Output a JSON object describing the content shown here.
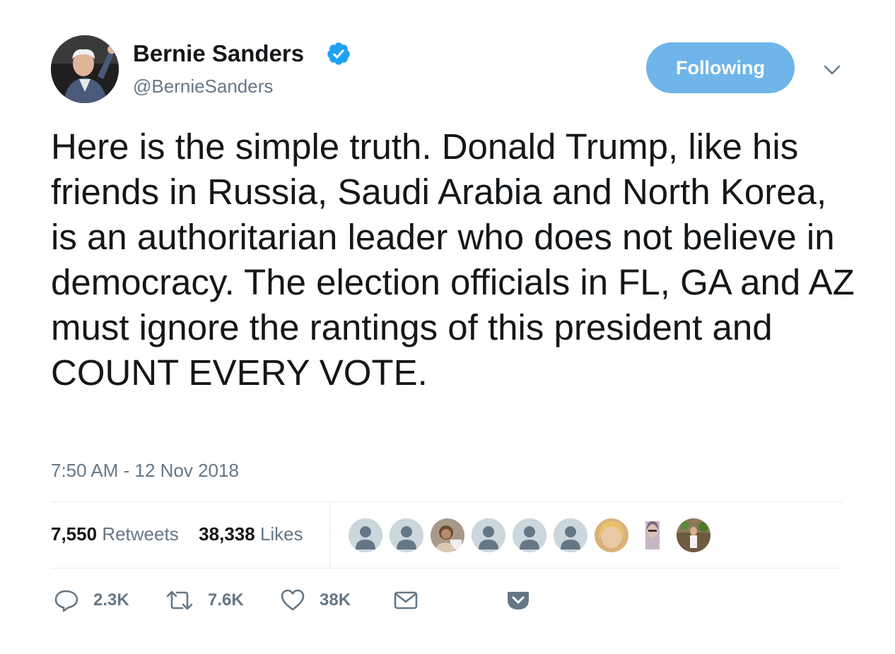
{
  "author": {
    "name": "Bernie Sanders",
    "handle": "@BernieSanders",
    "verified": true
  },
  "follow_button": {
    "label": "Following"
  },
  "tweet": {
    "text": "Here is the simple truth. Donald Trump, like his friends in Russia, Saudi Arabia and North Korea, is an authoritarian leader who does not believe in democracy. The election officials in FL, GA and AZ must ignore the rantings of this president and COUNT EVERY VOTE.",
    "timestamp": "7:50 AM - 12 Nov 2018"
  },
  "stats": {
    "retweets_count": "7,550",
    "retweets_label": "Retweets",
    "likes_count": "38,338",
    "likes_label": "Likes"
  },
  "actions": {
    "reply_count": "2.3K",
    "retweet_count": "7.6K",
    "like_count": "38K"
  },
  "colors": {
    "accent": "#1da1f2",
    "follow_button_bg": "#6fb5e9",
    "secondary_text": "#657786",
    "divider": "#e6ecf0"
  },
  "icons": [
    "verified-badge-icon",
    "chevron-down-icon",
    "reply-icon",
    "retweet-icon",
    "heart-icon",
    "envelope-icon",
    "pocket-icon"
  ]
}
